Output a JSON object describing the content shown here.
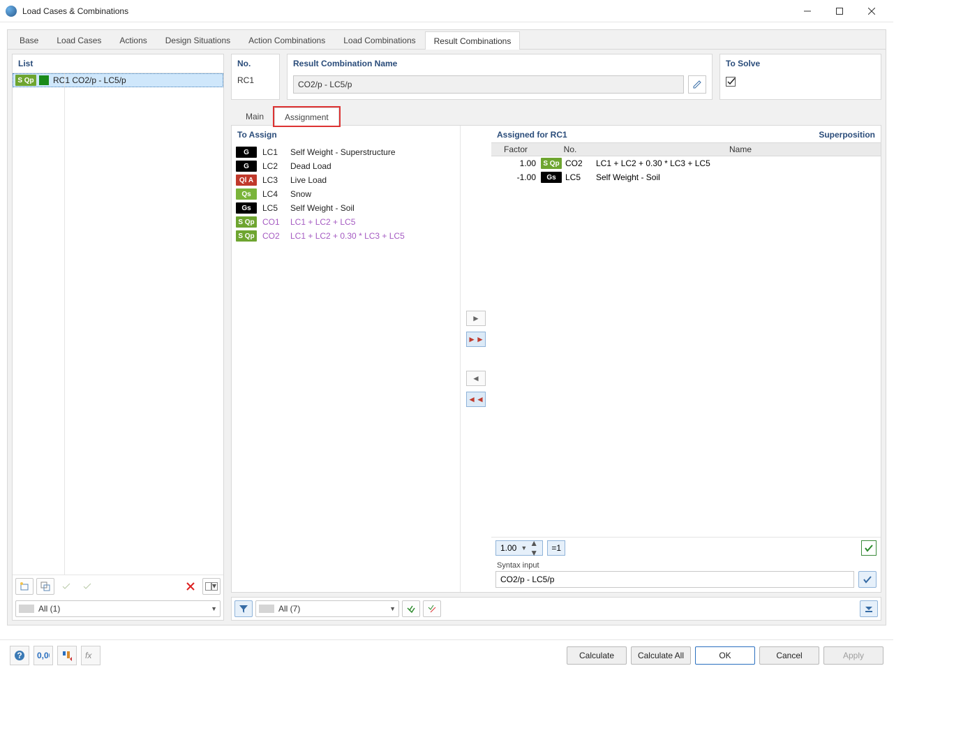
{
  "window": {
    "title": "Load Cases & Combinations"
  },
  "tabs": {
    "items": [
      {
        "label": "Base"
      },
      {
        "label": "Load Cases"
      },
      {
        "label": "Actions"
      },
      {
        "label": "Design Situations"
      },
      {
        "label": "Action Combinations"
      },
      {
        "label": "Load Combinations"
      },
      {
        "label": "Result Combinations"
      }
    ],
    "active_index": 6
  },
  "list": {
    "header": "List",
    "items": [
      {
        "badge": "S Qp",
        "badge_class": "sop",
        "text": "RC1  CO2/p - LC5/p",
        "selected": true
      }
    ],
    "filter": "All (1)"
  },
  "header": {
    "no_label": "No.",
    "no_value": "RC1",
    "name_label": "Result Combination Name",
    "name_value": "CO2/p - LC5/p",
    "solve_label": "To Solve",
    "solve_checked": true
  },
  "subtabs": {
    "main": "Main",
    "assignment": "Assignment"
  },
  "to_assign": {
    "header": "To Assign",
    "rows": [
      {
        "badge": "G",
        "badge_class": "g",
        "code": "LC1",
        "name": "Self Weight - Superstructure"
      },
      {
        "badge": "G",
        "badge_class": "g",
        "code": "LC2",
        "name": "Dead Load"
      },
      {
        "badge": "Ql A",
        "badge_class": "qia",
        "code": "LC3",
        "name": "Live Load"
      },
      {
        "badge": "Qs",
        "badge_class": "qs",
        "code": "LC4",
        "name": "Snow"
      },
      {
        "badge": "Gs",
        "badge_class": "gs",
        "code": "LC5",
        "name": "Self Weight - Soil"
      },
      {
        "badge": "S Qp",
        "badge_class": "sop",
        "code": "CO1",
        "name": "LC1 + LC2 + LC5",
        "co": true
      },
      {
        "badge": "S Qp",
        "badge_class": "sop",
        "code": "CO2",
        "name": "LC1 + LC2 + 0.30 * LC3 + LC5",
        "co": true
      }
    ],
    "filter": "All (7)"
  },
  "assigned": {
    "header": "Assigned for RC1",
    "superposition": "Superposition",
    "columns": {
      "factor": "Factor",
      "no": "No.",
      "name": "Name"
    },
    "rows": [
      {
        "factor": "1.00",
        "badge": "S Qp",
        "badge_class": "sop",
        "code": "CO2",
        "name": "LC1 + LC2 + 0.30 * LC3 + LC5"
      },
      {
        "factor": "-1.00",
        "badge": "Gs",
        "badge_class": "gs",
        "code": "LC5",
        "name": "Self Weight - Soil"
      }
    ],
    "factor_value": "1.00",
    "eq_label": "=1",
    "syntax_label": "Syntax input",
    "syntax_value": "CO2/p - LC5/p"
  },
  "footer": {
    "calculate": "Calculate",
    "calculate_all": "Calculate All",
    "ok": "OK",
    "cancel": "Cancel",
    "apply": "Apply"
  }
}
